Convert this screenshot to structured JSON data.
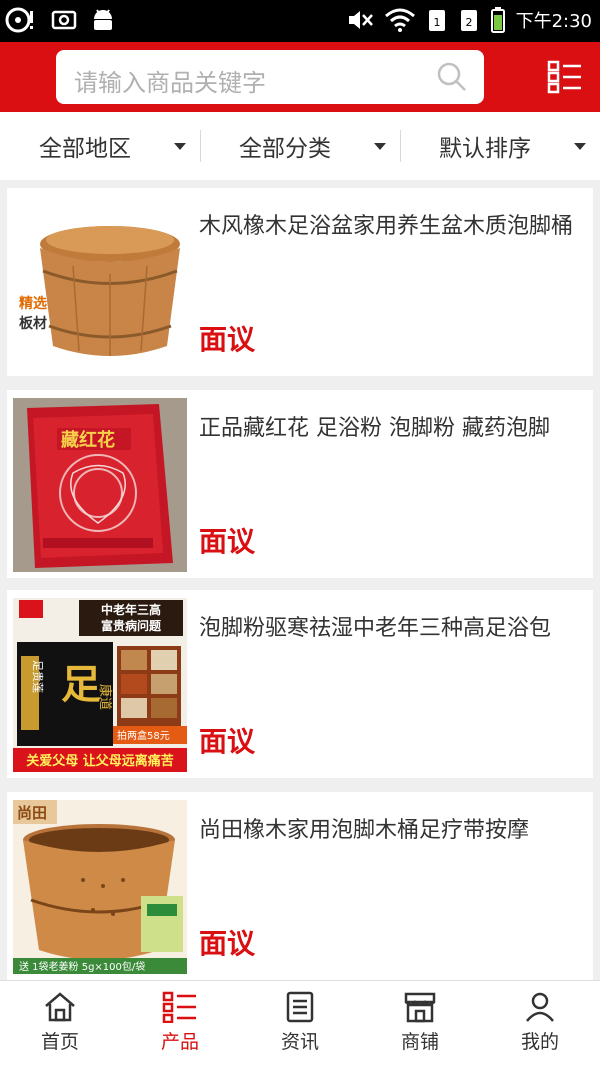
{
  "status_bar": {
    "time": "下午2:30",
    "icons": [
      "sync-icon",
      "screenshot-icon",
      "android-icon",
      "mute-icon",
      "wifi-icon",
      "sim1-icon",
      "sim2-icon",
      "battery-icon"
    ]
  },
  "header": {
    "search_placeholder": "请输入商品关键字",
    "search_icon": "search-icon",
    "menu_icon": "category-menu-icon"
  },
  "filters": [
    {
      "label": "全部地区"
    },
    {
      "label": "全部分类"
    },
    {
      "label": "默认排序"
    }
  ],
  "products": [
    {
      "title": "木风橡木足浴盆家用养生盆木质泡脚桶",
      "price": "面议",
      "thumb_text": [
        "精选",
        "板材"
      ]
    },
    {
      "title": "正品藏红花 足浴粉 泡脚粉 藏药泡脚",
      "price": "面议",
      "thumb_text": [
        "藏红花"
      ]
    },
    {
      "title": "泡脚粉驱寒祛湿中老年三种高足浴包",
      "price": "面议",
      "thumb_text": [
        "中老年三高",
        "富贵病问题",
        "足贵莲",
        "康道",
        "拍两盒58元",
        "关爱父母 让父母远离痛苦"
      ]
    },
    {
      "title": "尚田橡木家用泡脚木桶足疗带按摩",
      "price": "面议",
      "thumb_text": [
        "尚田",
        "送 1袋老姜粉 5g×100包/袋"
      ]
    }
  ],
  "bottom_nav": [
    {
      "label": "首页",
      "icon": "home-icon",
      "active": false
    },
    {
      "label": "产品",
      "icon": "products-icon",
      "active": true
    },
    {
      "label": "资讯",
      "icon": "news-icon",
      "active": false
    },
    {
      "label": "商铺",
      "icon": "shop-icon",
      "active": false
    },
    {
      "label": "我的",
      "icon": "user-icon",
      "active": false
    }
  ],
  "colors": {
    "brand_red": "#d90f12",
    "price_red": "#d90f12",
    "background": "#efefef"
  }
}
